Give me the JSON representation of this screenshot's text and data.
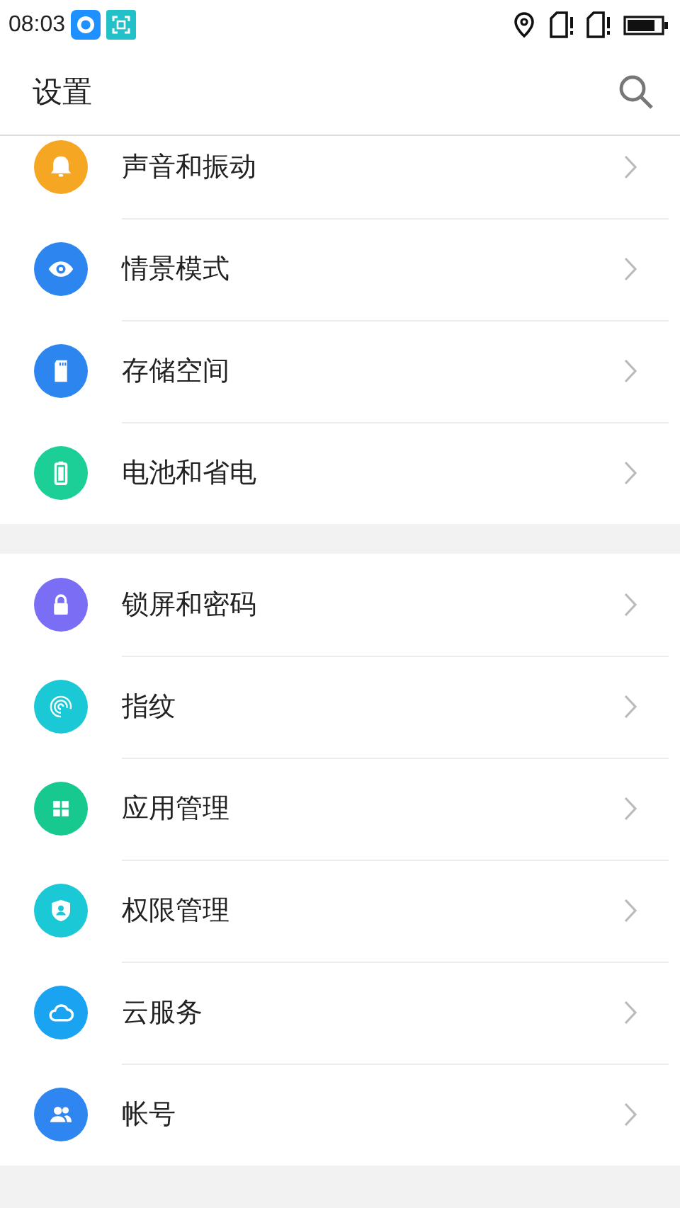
{
  "status_bar": {
    "time": "08:03"
  },
  "app_bar": {
    "title": "设置"
  },
  "groups": [
    {
      "items": [
        {
          "label": "声音和振动",
          "kind": "bell",
          "color": "#f5a623"
        },
        {
          "label": "情景模式",
          "kind": "eye",
          "color": "#2d86f0"
        },
        {
          "label": "存储空间",
          "kind": "sdcard",
          "color": "#2d86f0"
        },
        {
          "label": "电池和省电",
          "kind": "battery",
          "color": "#1ccf97"
        }
      ]
    },
    {
      "items": [
        {
          "label": "锁屏和密码",
          "kind": "lock",
          "color": "#7a6ef5"
        },
        {
          "label": "指纹",
          "kind": "fingerprint",
          "color": "#1bc8d6"
        },
        {
          "label": "应用管理",
          "kind": "apps",
          "color": "#18c98f"
        },
        {
          "label": "权限管理",
          "kind": "shield",
          "color": "#1bc8d6"
        },
        {
          "label": "云服务",
          "kind": "cloud",
          "color": "#1aa3f0"
        },
        {
          "label": "帐号",
          "kind": "people",
          "color": "#2f86f0"
        }
      ]
    }
  ]
}
